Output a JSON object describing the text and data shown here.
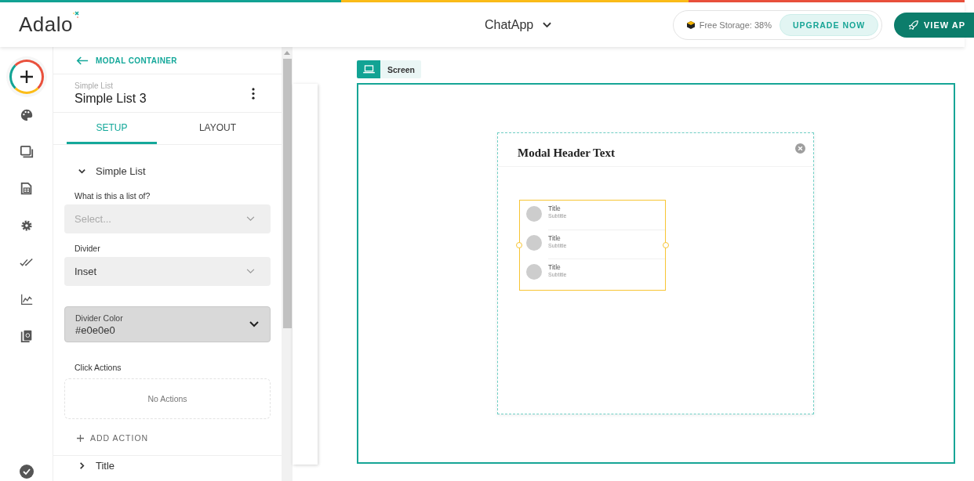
{
  "header": {
    "logo": "Adalo",
    "app_name": "ChatApp",
    "storage": "Free Storage: 38%",
    "upgrade_button": "UPGRADE NOW",
    "view_app_button": "VIEW AP"
  },
  "panel": {
    "back_link": "MODAL CONTAINER",
    "component_type": "Simple List",
    "component_name": "Simple List 3",
    "tabs": [
      {
        "label": "SETUP",
        "selected": true
      },
      {
        "label": "LAYOUT",
        "selected": false
      }
    ],
    "section": {
      "title": "Simple List",
      "expanded": true
    },
    "fields": [
      {
        "kind": "select",
        "label": "What is this a list of?",
        "placeholder": "Select..."
      },
      {
        "kind": "select",
        "label": "Divider",
        "value": "Inset"
      },
      {
        "kind": "color-select",
        "label": "Divider Color",
        "value": "#e0e0e0"
      }
    ],
    "click_actions": {
      "label": "Click Actions",
      "empty_text": "No Actions",
      "add_button": "ADD ACTION"
    },
    "next_section": {
      "title": "Title",
      "expanded": false
    }
  },
  "canvas": {
    "screen_label": "Screen",
    "modal": {
      "title": "Modal Header Text",
      "list_items": [
        {
          "title": "Title",
          "subtitle": "Subtitle"
        },
        {
          "title": "Title",
          "subtitle": "Subtitle"
        },
        {
          "title": "Title",
          "subtitle": "Subtitle"
        }
      ]
    }
  }
}
